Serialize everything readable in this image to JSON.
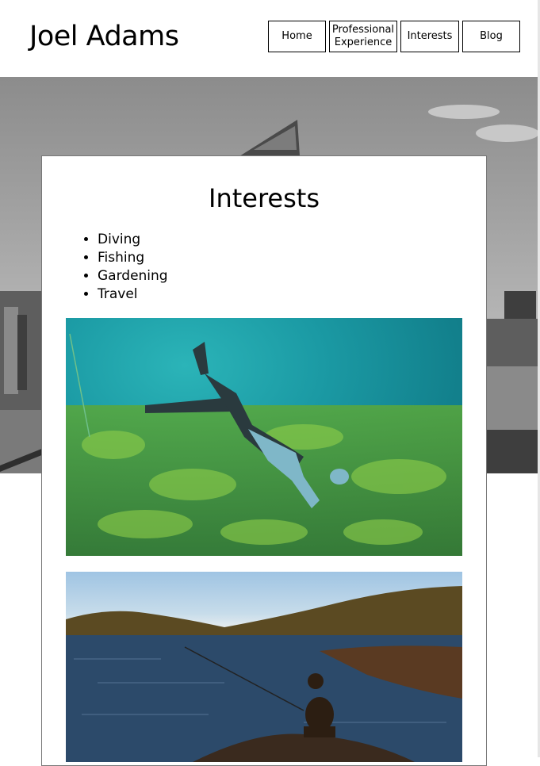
{
  "site": {
    "title": "Joel Adams"
  },
  "nav": {
    "home": "Home",
    "professional_experience": "Professional Experience",
    "interests": "Interests",
    "blog": "Blog"
  },
  "main": {
    "heading": "Interests",
    "interests": [
      "Diving",
      "Fishing",
      "Gardening",
      "Travel"
    ]
  },
  "icons": {
    "hero": "city-skyline-greyscale-photo",
    "photo1": "underwater-diver-photo",
    "photo2": "rock-fishing-photo"
  },
  "colors": {
    "card_border": "#777777",
    "nav_border": "#000000"
  }
}
